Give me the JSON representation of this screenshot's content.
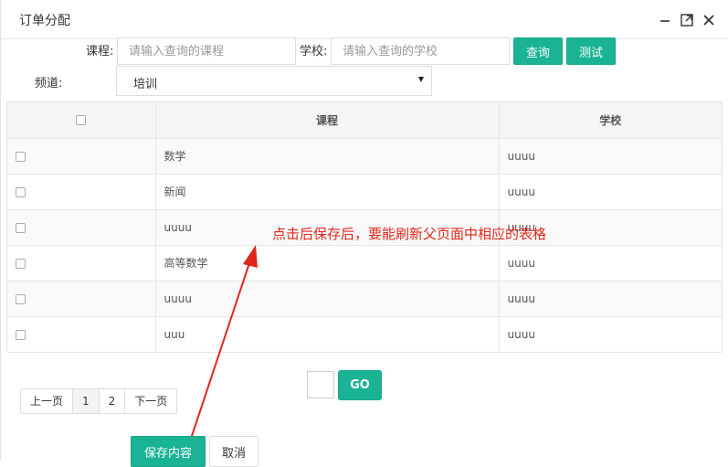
{
  "dialog": {
    "title": "订单分配"
  },
  "filters": {
    "course_label": "课程:",
    "course_placeholder": "请输入查询的课程",
    "school_label": "学校:",
    "school_placeholder": "请输入查询的学校",
    "query_button": "查询",
    "test_button": "测试",
    "channel_label": "频道:",
    "channel_selected": "培训"
  },
  "table": {
    "columns": [
      "",
      "课程",
      "学校"
    ],
    "rows": [
      {
        "course": "数学",
        "school": "uuuu"
      },
      {
        "course": "新闻",
        "school": "uuuu"
      },
      {
        "course": "uuuu",
        "school": "uuuu"
      },
      {
        "course": "高等数学",
        "school": "uuuu"
      },
      {
        "course": "uuuu",
        "school": "uuuu"
      },
      {
        "course": "uuu",
        "school": "uuuu"
      }
    ]
  },
  "annotation": {
    "text": "点击后保存后，要能刷新父页面中相应的表格",
    "color": "#e0261b"
  },
  "pagination": {
    "prev": "上一页",
    "pages": [
      "1",
      "2"
    ],
    "next": "下一页",
    "go_label": "GO"
  },
  "footer": {
    "save_button": "保存内容",
    "cancel_button": "取消"
  },
  "colors": {
    "accent": "#1ab394"
  }
}
